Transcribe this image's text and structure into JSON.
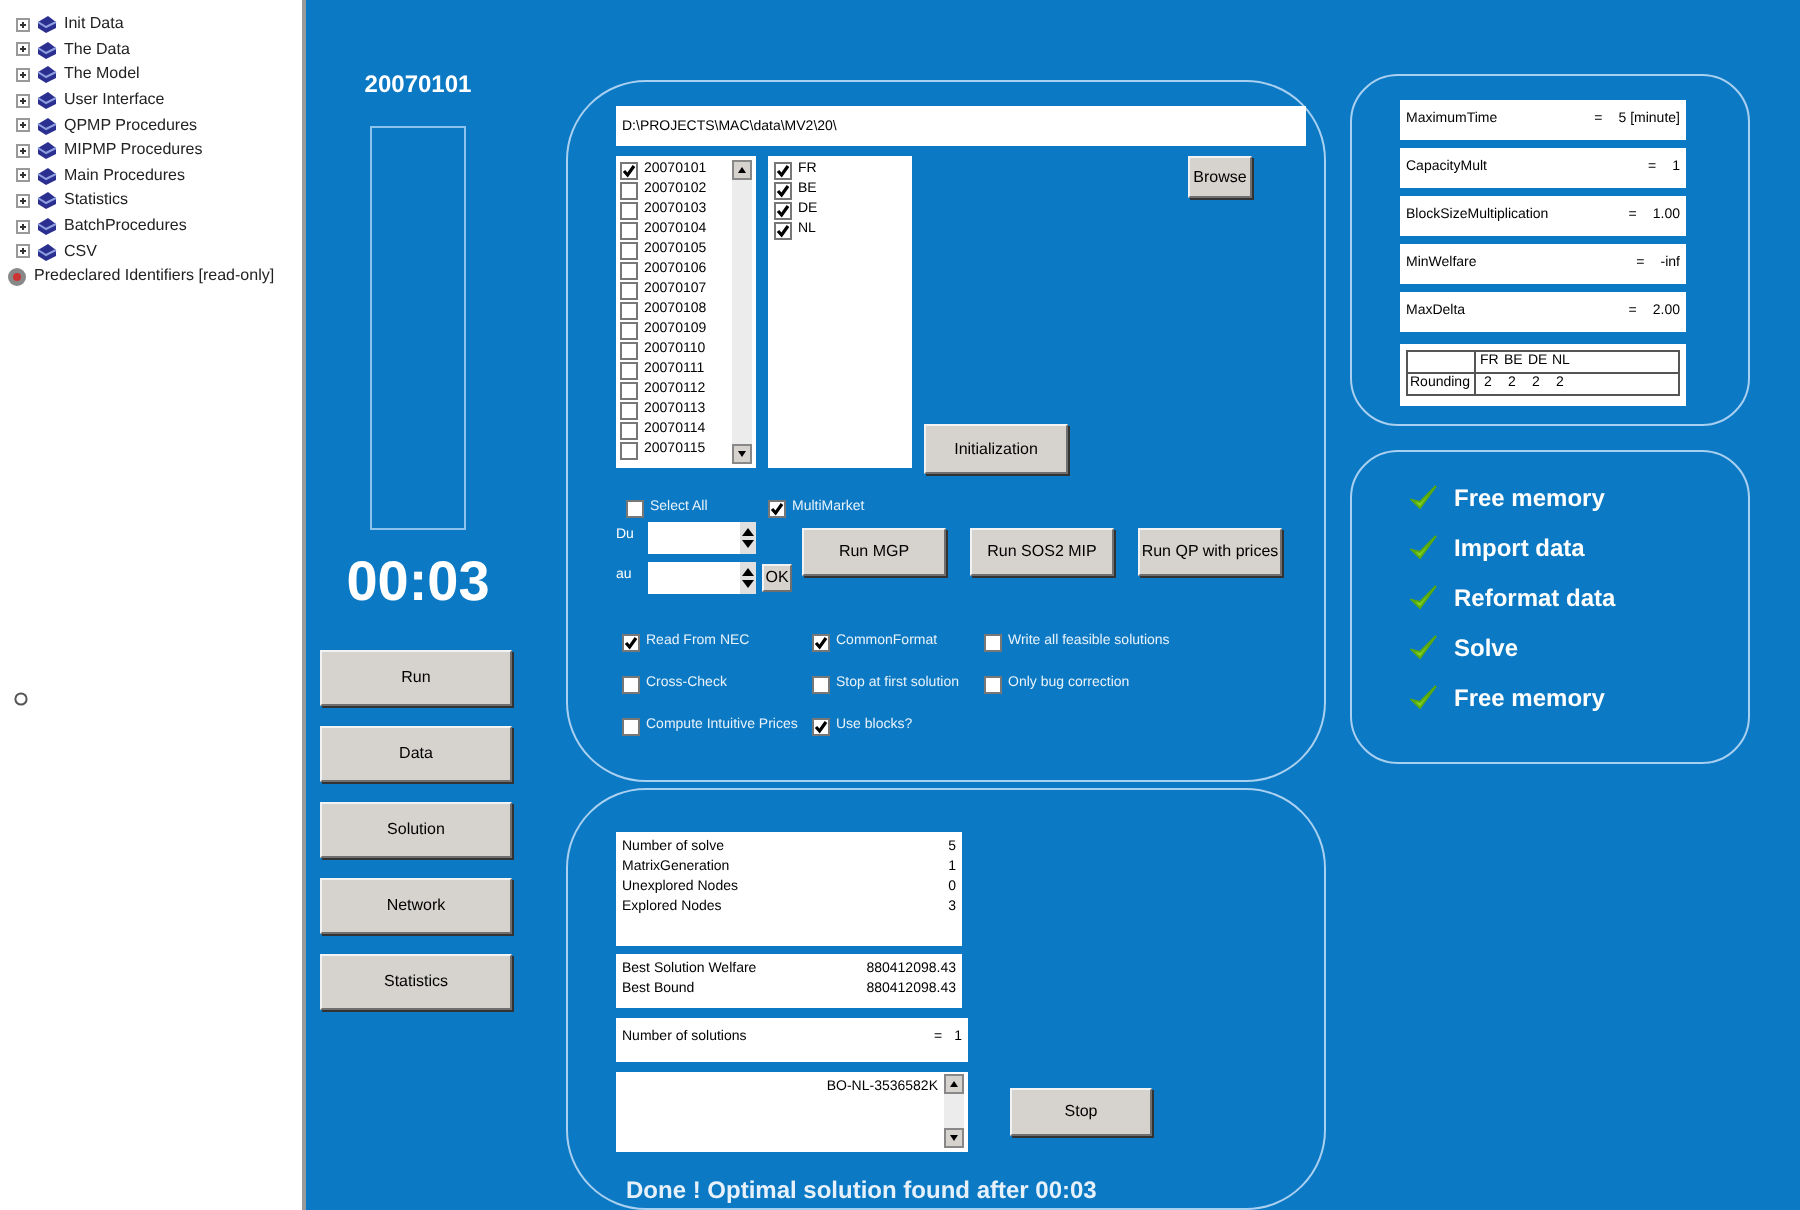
{
  "tree": [
    {
      "label": "Init Data",
      "kind": "book"
    },
    {
      "label": "The Data",
      "kind": "book"
    },
    {
      "label": "The Model",
      "kind": "book"
    },
    {
      "label": "User Interface",
      "kind": "book"
    },
    {
      "label": "QPMP Procedures",
      "kind": "book"
    },
    {
      "label": "MIPMP Procedures",
      "kind": "book"
    },
    {
      "label": "Main Procedures",
      "kind": "book"
    },
    {
      "label": "Statistics",
      "kind": "book"
    },
    {
      "label": "BatchProcedures",
      "kind": "book"
    },
    {
      "label": "CSV",
      "kind": "book"
    },
    {
      "label": "Predeclared Identifiers [read-only]",
      "kind": "predeclared"
    }
  ],
  "side": {
    "date": "20070101",
    "progress": {
      "level": 0
    },
    "timer": "00:03",
    "buttons": [
      "Run",
      "Data",
      "Solution",
      "Network",
      "Statistics"
    ]
  },
  "setup": {
    "path": "D:\\PROJECTS\\MAC\\data\\MV2\\20\\",
    "dates": [
      {
        "label": "20070101",
        "checked": true
      },
      {
        "label": "20070102",
        "checked": false
      },
      {
        "label": "20070103",
        "checked": false
      },
      {
        "label": "20070104",
        "checked": false
      },
      {
        "label": "20070105",
        "checked": false
      },
      {
        "label": "20070106",
        "checked": false
      },
      {
        "label": "20070107",
        "checked": false
      },
      {
        "label": "20070108",
        "checked": false
      },
      {
        "label": "20070109",
        "checked": false
      },
      {
        "label": "20070110",
        "checked": false
      },
      {
        "label": "20070111",
        "checked": false
      },
      {
        "label": "20070112",
        "checked": false
      },
      {
        "label": "20070113",
        "checked": false
      },
      {
        "label": "20070114",
        "checked": false
      },
      {
        "label": "20070115",
        "checked": false
      }
    ],
    "countries": [
      {
        "label": "FR",
        "checked": true
      },
      {
        "label": "BE",
        "checked": true
      },
      {
        "label": "DE",
        "checked": true
      },
      {
        "label": "NL",
        "checked": true
      }
    ],
    "browse": "Browse",
    "initialization": "Initialization",
    "select_all": {
      "label": "Select All",
      "checked": false
    },
    "multimarket": {
      "label": "MultiMarket",
      "checked": true
    },
    "du": "Du",
    "au": "au",
    "ok": "OK",
    "run_buttons": [
      "Run MGP",
      "Run SOS2 MIP",
      "Run QP with prices"
    ],
    "options": [
      {
        "label": "Read From NEC",
        "checked": true
      },
      {
        "label": "CommonFormat",
        "checked": true
      },
      {
        "label": "Write all feasible solutions",
        "checked": false
      },
      {
        "label": "Cross-Check",
        "checked": false
      },
      {
        "label": "Stop at first solution",
        "checked": false
      },
      {
        "label": "Only bug correction",
        "checked": false
      },
      {
        "label": "Compute Intuitive Prices",
        "checked": false
      },
      {
        "label": "Use blocks?",
        "checked": true
      }
    ]
  },
  "params": [
    {
      "name": "MaximumTime",
      "eq": "=",
      "value": "5 [minute]"
    },
    {
      "name": "CapacityMult",
      "eq": "=",
      "value": "1"
    },
    {
      "name": "BlockSizeMultiplication",
      "eq": "=",
      "value": "1.00"
    },
    {
      "name": "MinWelfare",
      "eq": "=",
      "value": "-inf"
    },
    {
      "name": "MaxDelta",
      "eq": "=",
      "value": "2.00"
    }
  ],
  "rounding": {
    "columns": [
      "FR",
      "BE",
      "DE",
      "NL"
    ],
    "label": "Rounding",
    "values": [
      "2",
      "2",
      "2",
      "2"
    ]
  },
  "steps": [
    {
      "label": "Free memory",
      "done": true
    },
    {
      "label": "Import data",
      "done": true
    },
    {
      "label": "Reformat data",
      "done": true
    },
    {
      "label": "Solve",
      "done": true
    },
    {
      "label": "Free memory",
      "done": true
    }
  ],
  "results": {
    "stats": [
      {
        "label": "Number of solve",
        "value": "5"
      },
      {
        "label": "MatrixGeneration",
        "value": "1"
      },
      {
        "label": "Unexplored Nodes",
        "value": "0"
      },
      {
        "label": "Explored Nodes",
        "value": "3"
      }
    ],
    "best": [
      {
        "label": "Best Solution Welfare",
        "value": "880412098.43"
      },
      {
        "label": "Best Bound",
        "value": "880412098.43"
      }
    ],
    "solutions": {
      "label": "Number of solutions",
      "eq": "=",
      "value": "1"
    },
    "log": [
      "BO-NL-3536582K"
    ],
    "stop": "Stop",
    "message": "Done ! Optimal solution found after 00:03"
  }
}
